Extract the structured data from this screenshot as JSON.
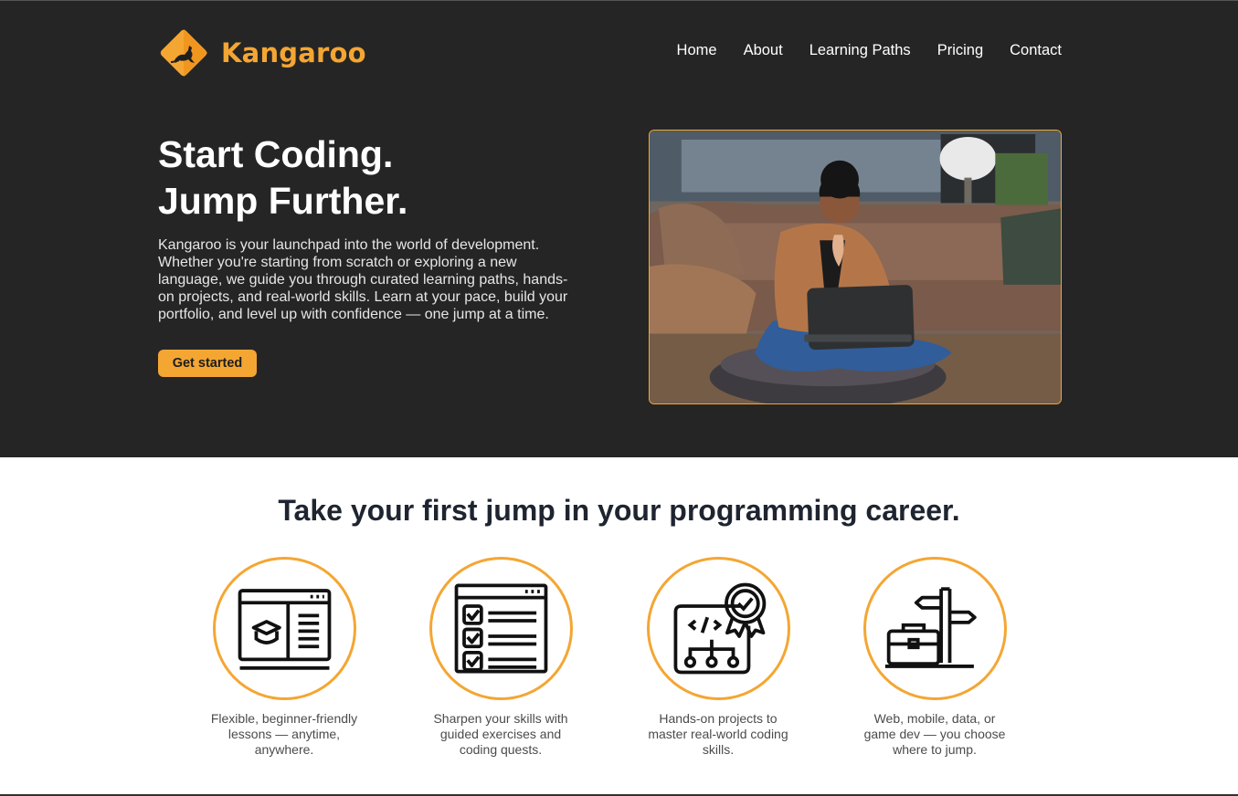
{
  "brand": {
    "name": "Kangaroo",
    "accent": "#f4a633",
    "logo_icon": "kangaroo-sign-icon"
  },
  "nav": [
    {
      "label": "Home"
    },
    {
      "label": "About"
    },
    {
      "label": "Learning Paths"
    },
    {
      "label": "Pricing"
    },
    {
      "label": "Contact"
    }
  ],
  "hero": {
    "title_line1": "Start Coding.",
    "title_line2": "Jump Further.",
    "description": "Kangaroo is your launchpad into the world of development. Whether you're starting from scratch or exploring a new language, we guide you through curated learning paths, hands-on projects, and real-world skills. Learn at your pace, build your portfolio, and level up with confidence — one jump at a time.",
    "cta_label": "Get started",
    "image": "woman-coding-on-laptop-photo"
  },
  "features": {
    "title": "Take your first jump in your programming career.",
    "items": [
      {
        "icon": "online-lesson-icon",
        "text": "Flexible, beginner-friendly lessons — anytime, anywhere."
      },
      {
        "icon": "checklist-icon",
        "text": "Sharpen your skills with guided exercises and coding quests."
      },
      {
        "icon": "code-project-icon",
        "text": "Hands-on projects to master real-world coding skills."
      },
      {
        "icon": "career-signpost-icon",
        "text": "Web, mobile, data, or game dev — you choose where to jump."
      }
    ]
  }
}
